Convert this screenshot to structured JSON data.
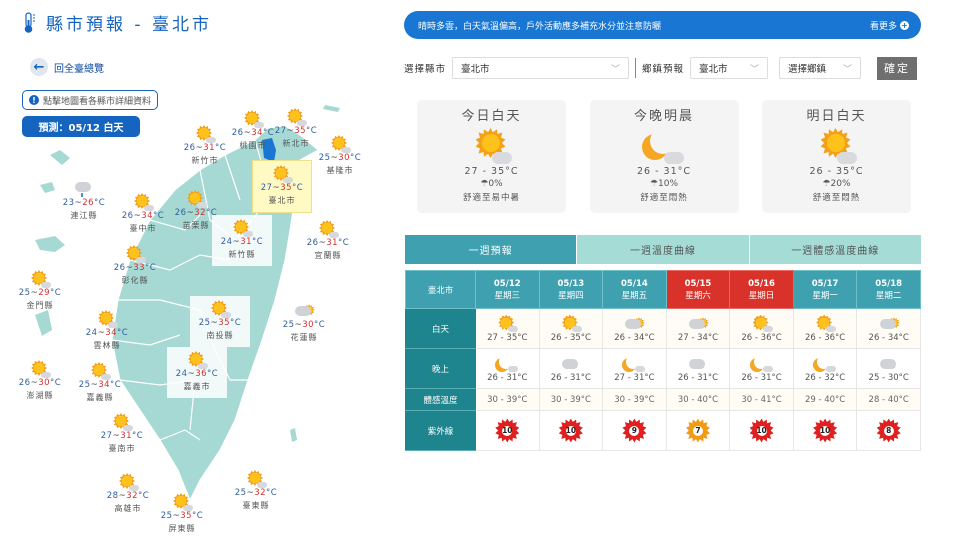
{
  "header": {
    "title": "縣市預報 - 臺北市",
    "icon": "thermometer-icon"
  },
  "left": {
    "back_label": "回全臺總覽",
    "hint_label": "點擊地圖看各縣市詳細資料",
    "forecast_label": "預測：05/12 白天"
  },
  "map": {
    "unit": "°C",
    "locations": [
      {
        "name": "桃園市",
        "low": "26",
        "high": "34",
        "weather": "sunny-cloudy"
      },
      {
        "name": "新北市",
        "low": "27",
        "high": "35",
        "weather": "sunny-cloudy"
      },
      {
        "name": "新竹市",
        "low": "26",
        "high": "31",
        "weather": "sunny-cloudy"
      },
      {
        "name": "基隆市",
        "low": "25",
        "high": "30",
        "weather": "sunny-cloudy"
      },
      {
        "name": "臺北市",
        "low": "27",
        "high": "35",
        "weather": "sunny-cloudy",
        "selected": true
      },
      {
        "name": "連江縣",
        "low": "23",
        "high": "26",
        "weather": "rain"
      },
      {
        "name": "臺中市",
        "low": "26",
        "high": "34",
        "weather": "sunny-cloudy"
      },
      {
        "name": "苗栗縣",
        "low": "26",
        "high": "32",
        "weather": "sunny-cloudy"
      },
      {
        "name": "新竹縣",
        "low": "24",
        "high": "31",
        "weather": "sunny-cloudy"
      },
      {
        "name": "宜蘭縣",
        "low": "26",
        "high": "31",
        "weather": "sunny-cloudy"
      },
      {
        "name": "彰化縣",
        "low": "26",
        "high": "33",
        "weather": "sunny-cloudy"
      },
      {
        "name": "金門縣",
        "low": "25",
        "high": "29",
        "weather": "sunny-cloudy"
      },
      {
        "name": "南投縣",
        "low": "25",
        "high": "35",
        "weather": "sunny-cloudy"
      },
      {
        "name": "花蓮縣",
        "low": "25",
        "high": "30",
        "weather": "cloudy-sunny"
      },
      {
        "name": "雲林縣",
        "low": "24",
        "high": "34",
        "weather": "sunny-cloudy"
      },
      {
        "name": "嘉義市",
        "low": "24",
        "high": "36",
        "weather": "sunny-cloudy"
      },
      {
        "name": "澎湖縣",
        "low": "26",
        "high": "30",
        "weather": "sunny-cloudy"
      },
      {
        "name": "嘉義縣",
        "low": "25",
        "high": "34",
        "weather": "sunny-cloudy"
      },
      {
        "name": "臺南市",
        "low": "27",
        "high": "31",
        "weather": "sunny-cloudy"
      },
      {
        "name": "高雄市",
        "low": "28",
        "high": "32",
        "weather": "sunny-cloudy"
      },
      {
        "name": "臺東縣",
        "low": "25",
        "high": "32",
        "weather": "sunny-cloudy"
      },
      {
        "name": "屏東縣",
        "low": "25",
        "high": "35",
        "weather": "sunny-cloudy"
      }
    ]
  },
  "banner": {
    "text": "晴時多雲，白天氣溫偏高，戶外活動應多補充水分並注意防曬",
    "more_label": "看更多"
  },
  "selectors": {
    "county_label": "選擇縣市",
    "county_value": "臺北市",
    "town_label": "鄉鎮預報",
    "town_county_value": "臺北市",
    "town_placeholder": "選擇鄉鎮",
    "confirm_label": "確定"
  },
  "cards": [
    {
      "title": "今日白天",
      "icon": "sunny-cloudy",
      "temp": "27 - 35°C",
      "rain": "0%",
      "comfort": "舒適至易中暑"
    },
    {
      "title": "今晚明晨",
      "icon": "moon-cloudy",
      "temp": "26 - 31°C",
      "rain": "10%",
      "comfort": "舒適至悶熱"
    },
    {
      "title": "明日白天",
      "icon": "sunny-cloudy",
      "temp": "26 - 35°C",
      "rain": "20%",
      "comfort": "舒適至悶熱"
    }
  ],
  "tabs": [
    {
      "label": "一週預報",
      "active": true
    },
    {
      "label": "一週溫度曲線",
      "active": false
    },
    {
      "label": "一週體感溫度曲線",
      "active": false
    }
  ],
  "week": {
    "city": "臺北市",
    "row_labels": {
      "day": "白天",
      "night": "晚上",
      "feel": "體感溫度",
      "uv": "紫外線"
    },
    "days": [
      {
        "date": "05/12",
        "weekday": "星期三",
        "weekend": false,
        "day_icon": "sunny-cloudy",
        "day_temp": "27 - 35°C",
        "night_icon": "moon-cloudy",
        "night_temp": "26 - 31°C",
        "feel": "30 - 39°C",
        "uv": "10",
        "uv_color": "#e02020"
      },
      {
        "date": "05/13",
        "weekday": "星期四",
        "weekend": false,
        "day_icon": "sunny-cloudy",
        "day_temp": "26 - 35°C",
        "night_icon": "cloudy-moon",
        "night_temp": "26 - 31°C",
        "feel": "30 - 39°C",
        "uv": "10",
        "uv_color": "#e02020"
      },
      {
        "date": "05/14",
        "weekday": "星期五",
        "weekend": false,
        "day_icon": "cloudy-sunny",
        "day_temp": "26 - 34°C",
        "night_icon": "moon-cloudy",
        "night_temp": "27 - 31°C",
        "feel": "30 - 39°C",
        "uv": "9",
        "uv_color": "#e02020"
      },
      {
        "date": "05/15",
        "weekday": "星期六",
        "weekend": true,
        "day_icon": "cloudy-sunny",
        "day_temp": "27 - 34°C",
        "night_icon": "cloudy-moon",
        "night_temp": "26 - 31°C",
        "feel": "30 - 40°C",
        "uv": "7",
        "uv_color": "#f29b12"
      },
      {
        "date": "05/16",
        "weekday": "星期日",
        "weekend": true,
        "day_icon": "sunny-cloudy",
        "day_temp": "26 - 36°C",
        "night_icon": "moon-cloudy",
        "night_temp": "26 - 31°C",
        "feel": "30 - 41°C",
        "uv": "10",
        "uv_color": "#e02020"
      },
      {
        "date": "05/17",
        "weekday": "星期一",
        "weekend": false,
        "day_icon": "sunny-cloudy",
        "day_temp": "26 - 36°C",
        "night_icon": "moon-cloudy",
        "night_temp": "26 - 32°C",
        "feel": "29 - 40°C",
        "uv": "10",
        "uv_color": "#e02020"
      },
      {
        "date": "05/18",
        "weekday": "星期二",
        "weekend": false,
        "day_icon": "cloudy-sunny",
        "day_temp": "26 - 34°C",
        "night_icon": "cloudy-moon",
        "night_temp": "25 - 30°C",
        "feel": "28 - 40°C",
        "uv": "8",
        "uv_color": "#e02020"
      }
    ]
  }
}
